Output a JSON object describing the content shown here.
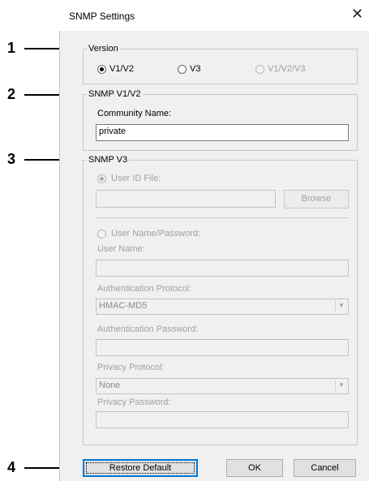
{
  "callouts": [
    "1",
    "2",
    "3",
    "4"
  ],
  "dialog": {
    "title": "SNMP Settings",
    "close_glyph": "✕"
  },
  "version_group": {
    "legend": "Version",
    "options": [
      {
        "label": "V1/V2",
        "selected": true,
        "enabled": true
      },
      {
        "label": "V3",
        "selected": false,
        "enabled": true
      },
      {
        "label": "V1/V2/V3",
        "selected": false,
        "enabled": false
      }
    ]
  },
  "v1v2_group": {
    "legend": "SNMP V1/V2",
    "community_label": "Community Name:",
    "community_value": "private"
  },
  "v3_group": {
    "legend": "SNMP V3",
    "user_id_file_label": "User ID File:",
    "user_id_file_value": "",
    "browse_label": "Browse",
    "user_name_password_label": "User Name/Password:",
    "user_name_label": "User Name:",
    "user_name_value": "",
    "auth_protocol_label": "Authentication Protocol:",
    "auth_protocol_value": "HMAC-MD5",
    "auth_password_label": "Authentication Password:",
    "auth_password_value": "",
    "privacy_protocol_label": "Privacy Protocol:",
    "privacy_protocol_value": "None",
    "privacy_password_label": "Privacy Password:",
    "privacy_password_value": ""
  },
  "buttons": {
    "restore_default": "Restore Default",
    "ok": "OK",
    "cancel": "Cancel"
  }
}
